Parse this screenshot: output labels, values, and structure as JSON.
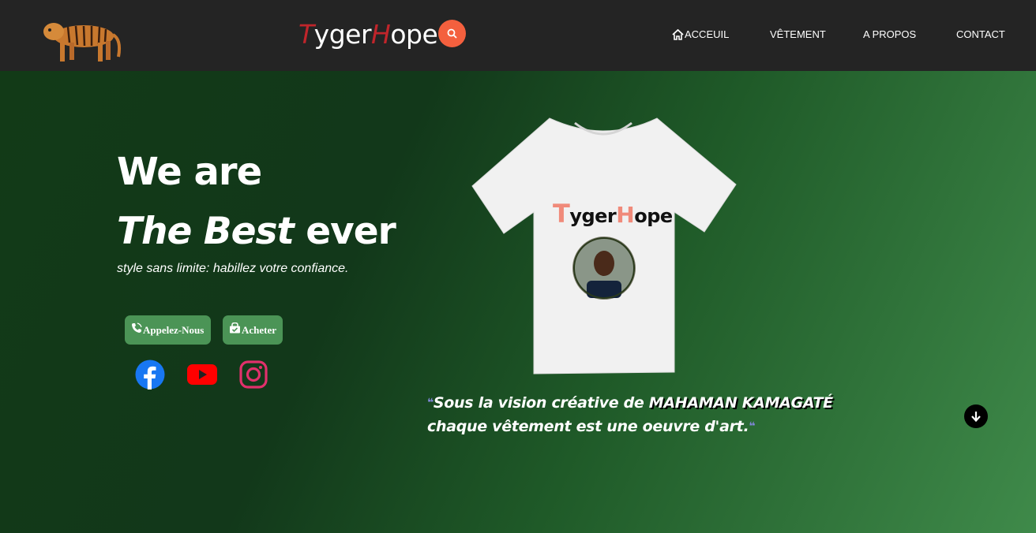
{
  "nav": {
    "brand_first_letter": "T",
    "brand_mid": "yger",
    "brand_second_letter": "H",
    "brand_end": "ope",
    "search_icon": "search-icon",
    "menu": [
      "ACCEUIL",
      "VÊTEMENT",
      "A PROPOS",
      "CONTACT"
    ],
    "brand_accent_color": "#c0252b",
    "search_color": "#f4603e"
  },
  "hero": {
    "headline_line1": "We are",
    "headline_italic": "The Best",
    "headline_end": " ever",
    "tagline": "style sans limite: habillez votre confiance.",
    "buttons": [
      "Appelez-Nous",
      "Acheter"
    ],
    "button_color": "#4b9456",
    "social_icons": [
      "facebook-icon",
      "youtube-icon",
      "instagram-icon"
    ],
    "shirt_print": {
      "first": "T",
      "mid": "yger",
      "second": "H",
      "end": "ope"
    },
    "quote_part1": "Sous la vision créative de ",
    "quote_name": "MAHAMAN KAMAGATÉ",
    "quote_part2": "chaque vêtement est une oeuvre d'art.",
    "scroll_icon": "arrow-down-icon"
  }
}
